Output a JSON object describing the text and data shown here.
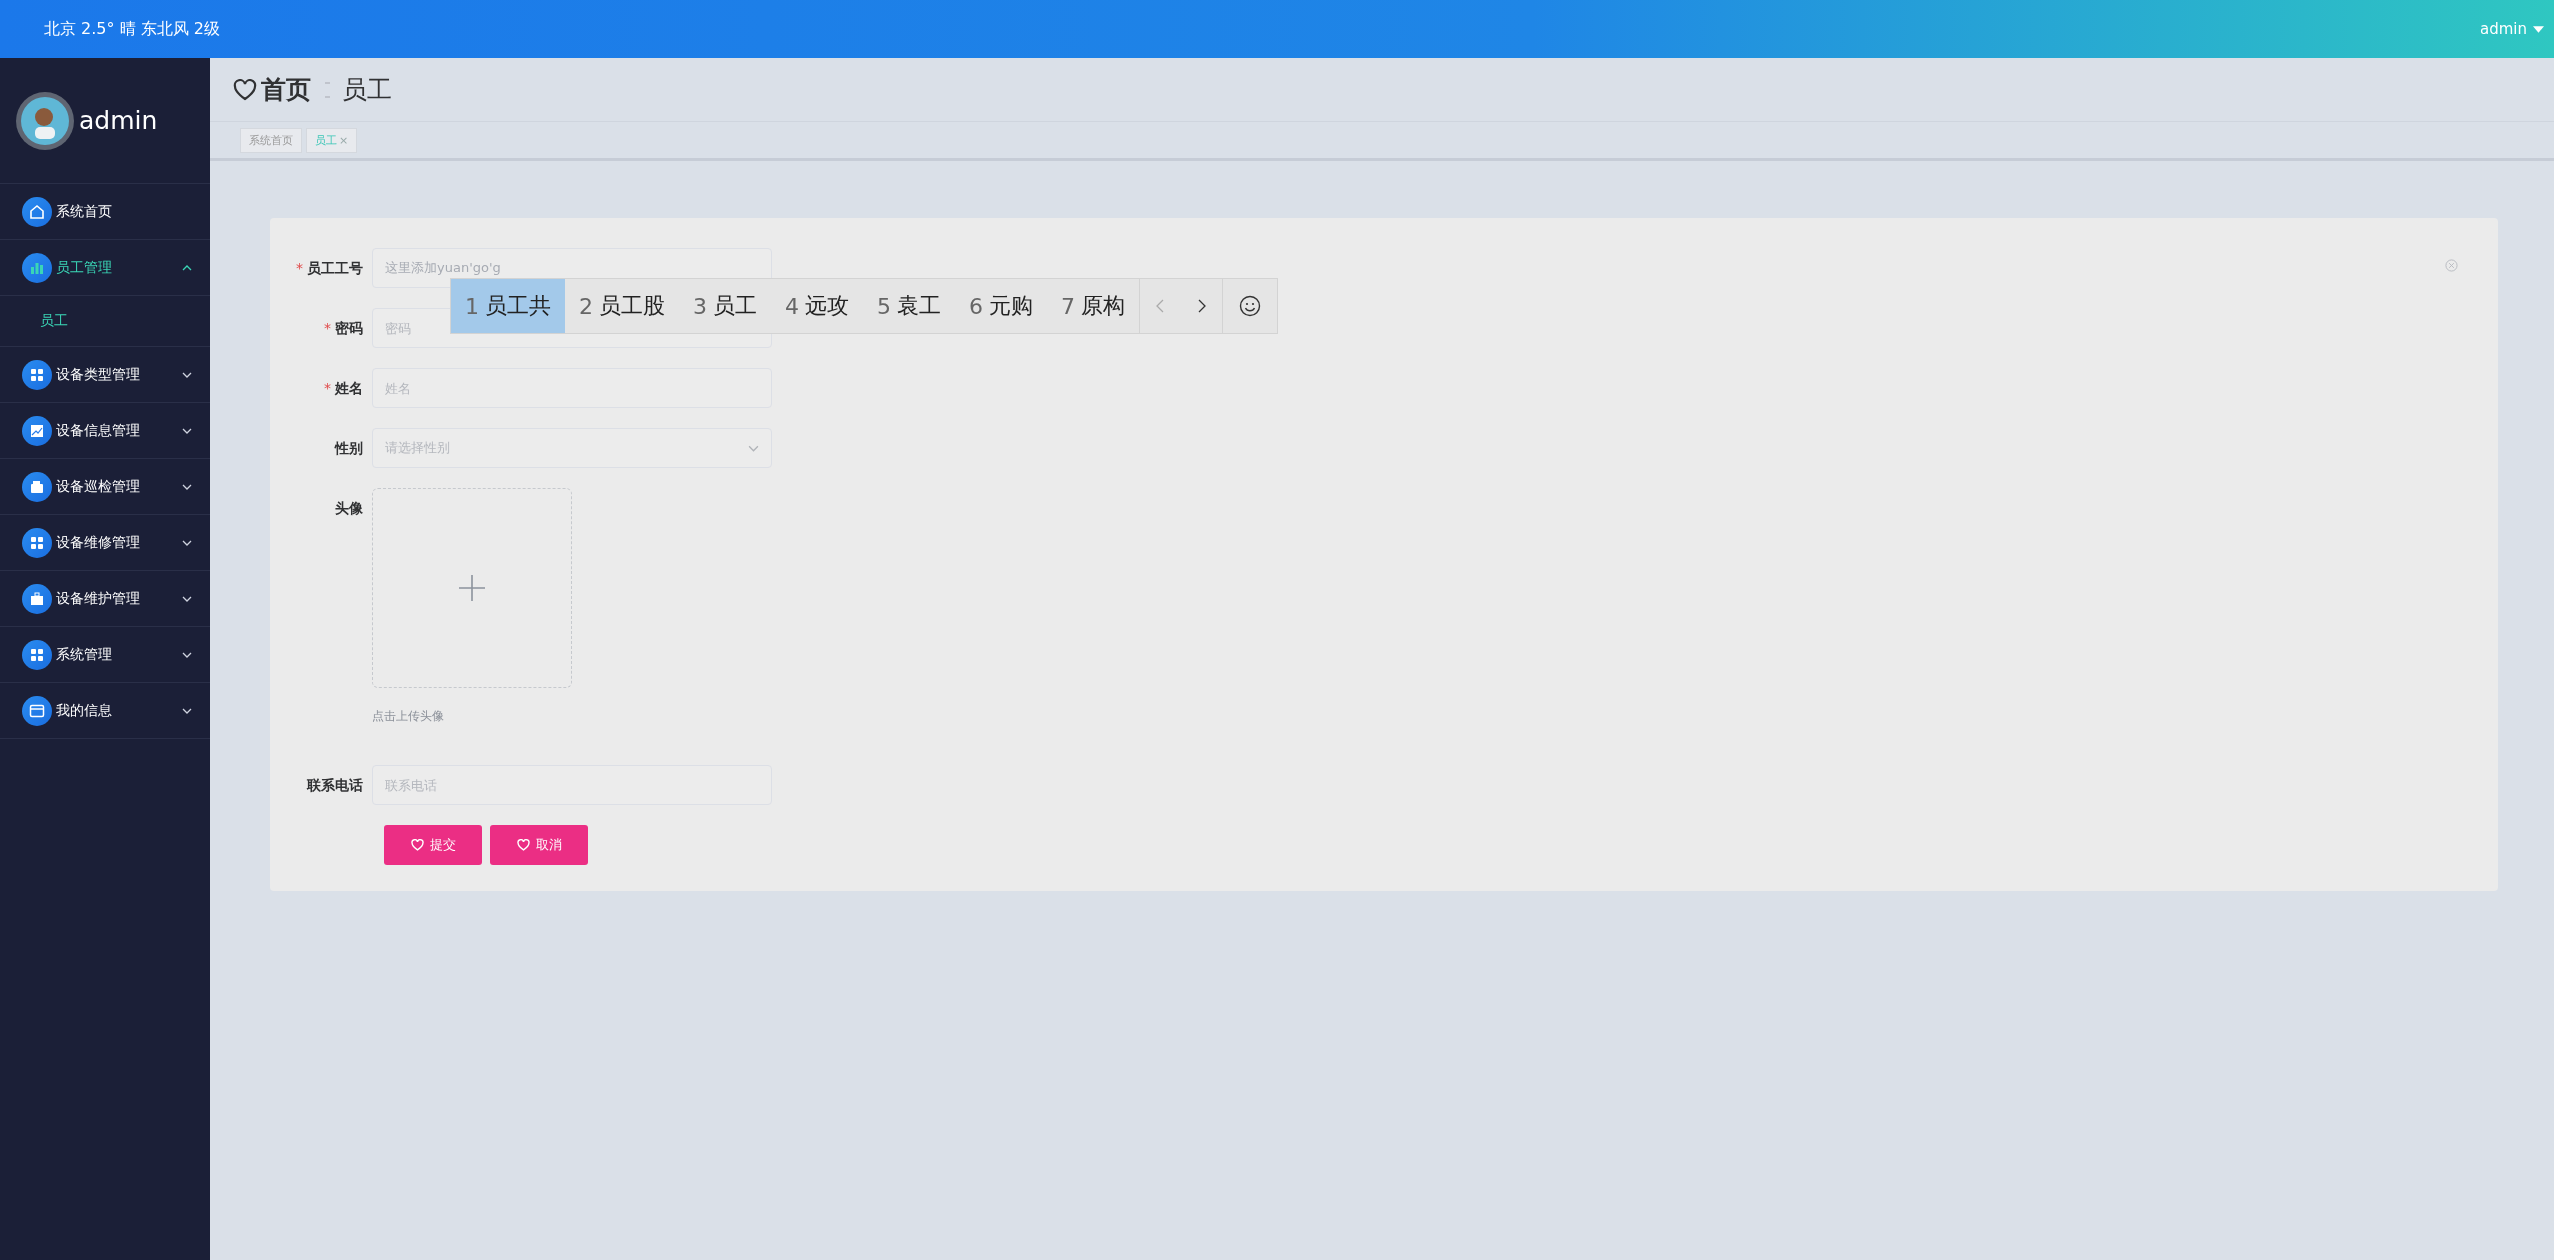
{
  "topbar": {
    "weather": "北京 2.5° 晴 东北风 2级",
    "user": "admin"
  },
  "sidebar": {
    "user": "admin",
    "menu": [
      {
        "label": "系统首页",
        "kind": "home",
        "selected": false
      },
      {
        "label": "员工管理",
        "kind": "chart",
        "selected": true,
        "expanded": true,
        "children": [
          {
            "label": "员工",
            "selected": true
          }
        ]
      },
      {
        "label": "设备类型管理",
        "kind": "grid",
        "selected": false,
        "expanded": false
      },
      {
        "label": "设备信息管理",
        "kind": "trend",
        "selected": false,
        "expanded": false
      },
      {
        "label": "设备巡检管理",
        "kind": "wallet",
        "selected": false,
        "expanded": false
      },
      {
        "label": "设备维修管理",
        "kind": "grid",
        "selected": false,
        "expanded": false
      },
      {
        "label": "设备维护管理",
        "kind": "briefcase",
        "selected": false,
        "expanded": false
      },
      {
        "label": "系统管理",
        "kind": "grid",
        "selected": false,
        "expanded": false
      },
      {
        "label": "我的信息",
        "kind": "card",
        "selected": false,
        "expanded": false
      }
    ]
  },
  "breadcrumb": [
    "首页",
    "员工"
  ],
  "tabs": [
    {
      "label": "系统首页",
      "selected": false
    },
    {
      "label": "员工",
      "selected": true,
      "close": "×"
    }
  ],
  "form": {
    "fields": [
      {
        "kind": "input",
        "label": "员工工号",
        "mark": "*",
        "value": "这里添加yuan'go'g"
      },
      {
        "kind": "input",
        "label": "密码",
        "mark": "*",
        "placeholder": "密码"
      },
      {
        "kind": "input",
        "label": "姓名",
        "mark": "*",
        "placeholder": "姓名"
      },
      {
        "kind": "select",
        "label": "性别",
        "placeholder": "请选择性别"
      },
      {
        "kind": "upload",
        "label": "头像",
        "hint": "点击上传头像"
      },
      {
        "kind": "input",
        "label": "联系电话",
        "placeholder": "联系电话"
      }
    ],
    "buttons": [
      "提交",
      "取消"
    ]
  },
  "ime": {
    "candidates": [
      {
        "index": "1",
        "text": "员工共",
        "selected": true
      },
      {
        "index": "2",
        "text": "员工股",
        "selected": false
      },
      {
        "index": "3",
        "text": "员工",
        "selected": false
      },
      {
        "index": "4",
        "text": "远攻",
        "selected": false
      },
      {
        "index": "5",
        "text": "袁工",
        "selected": false
      },
      {
        "index": "6",
        "text": "元购",
        "selected": false
      },
      {
        "index": "7",
        "text": "原构",
        "selected": false
      }
    ]
  }
}
